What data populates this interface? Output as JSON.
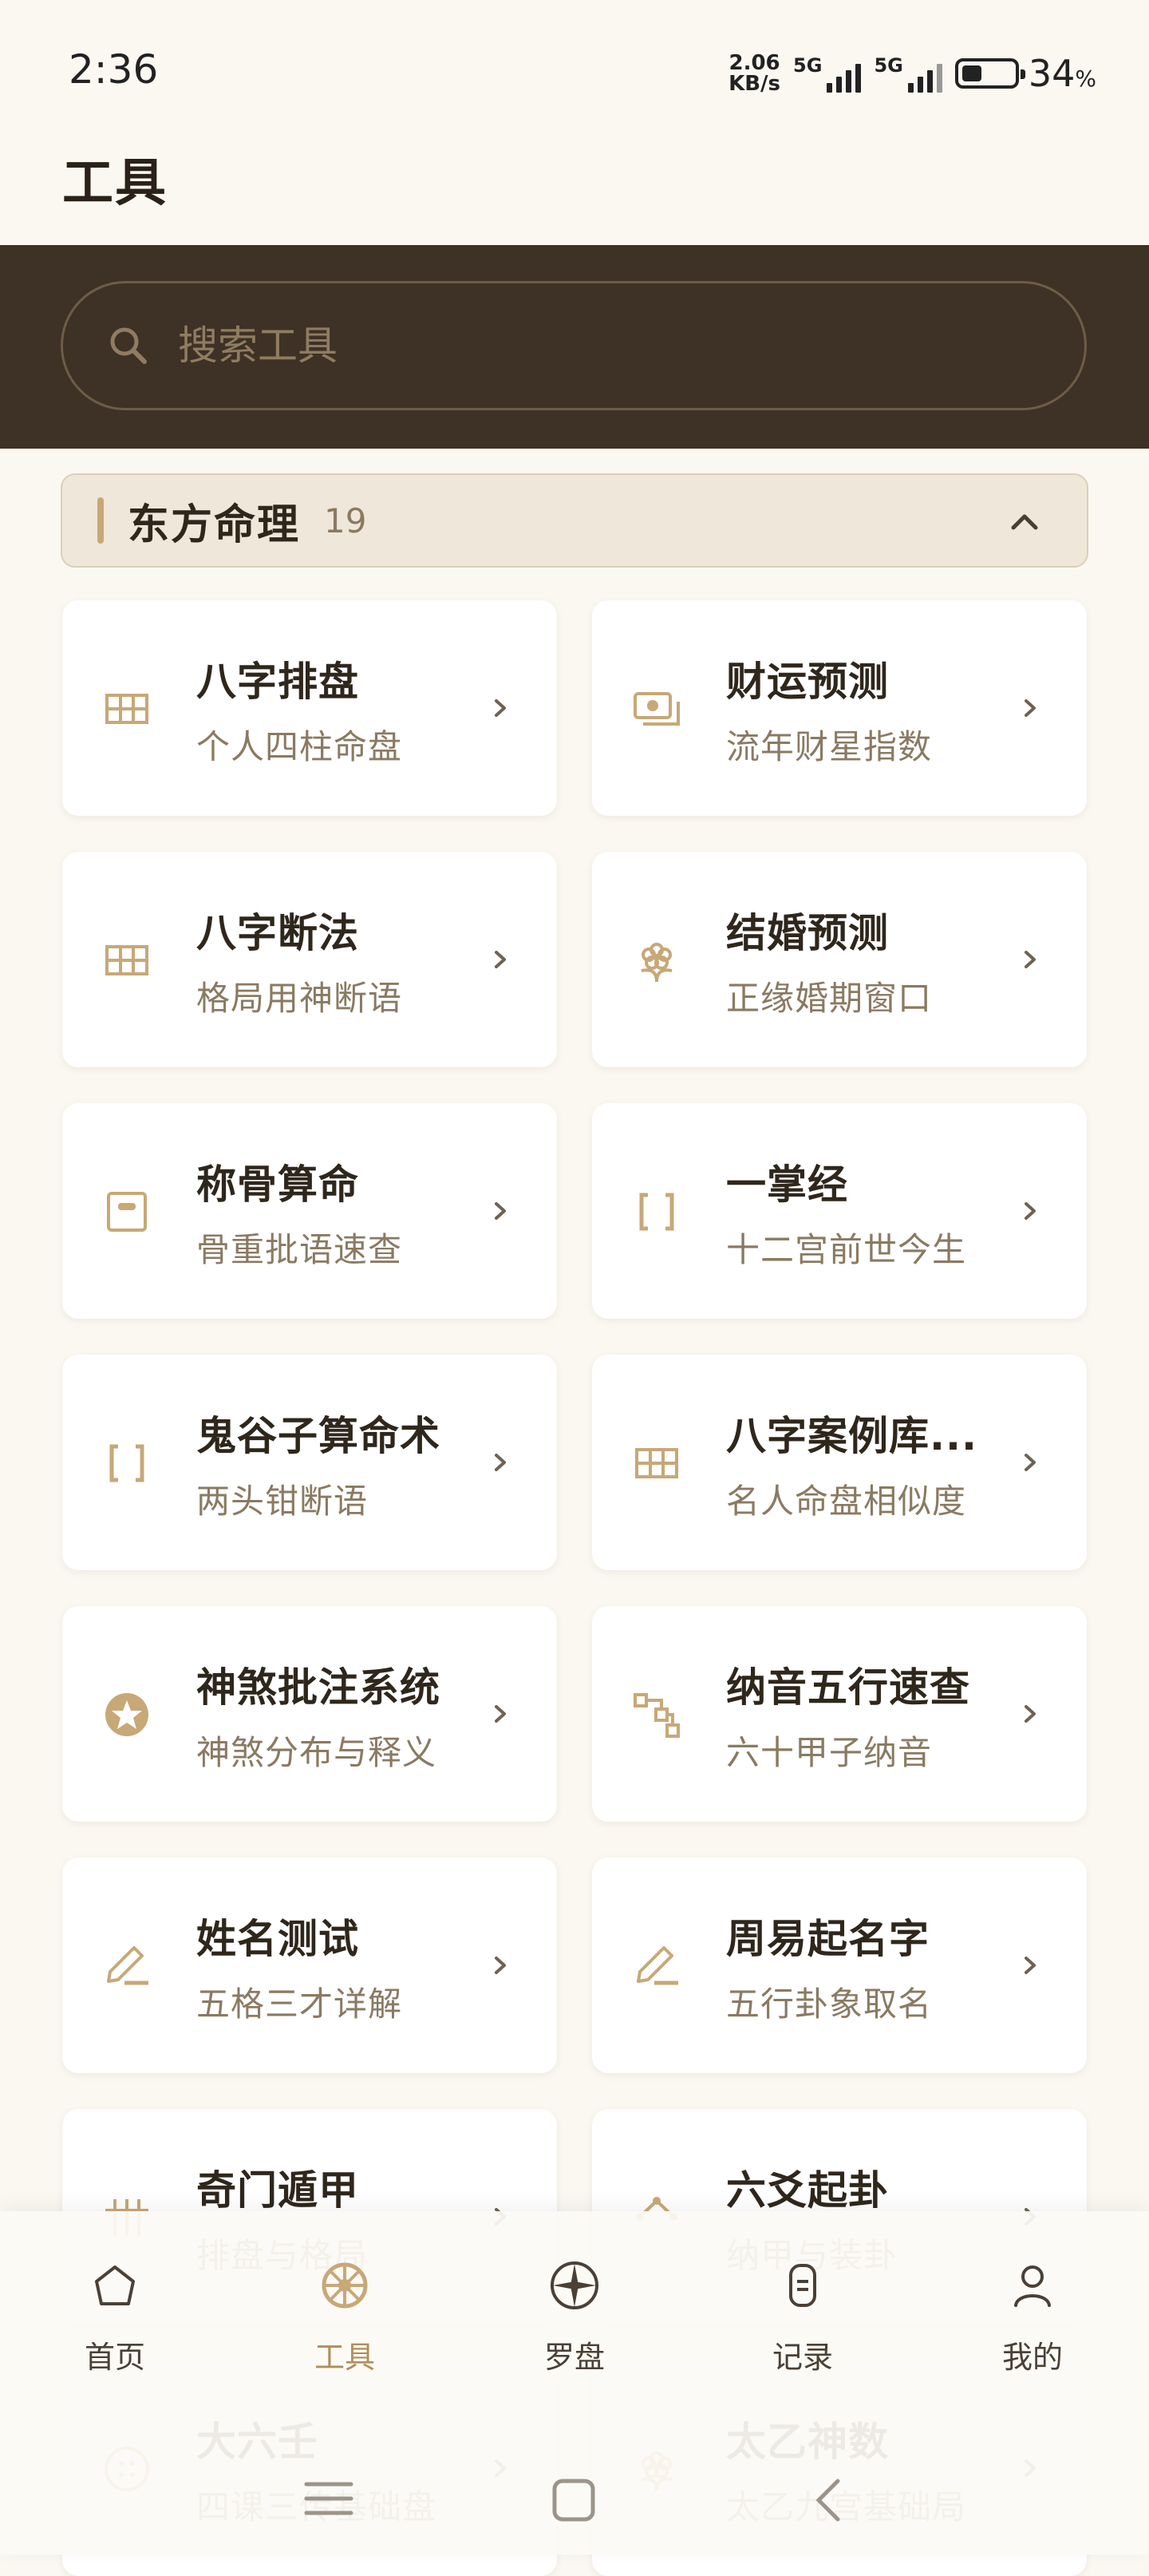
{
  "status": {
    "time": "2:36",
    "speed_value": "2.06",
    "speed_unit": "KB/s",
    "net1": "5G",
    "net2": "5G",
    "battery": "34",
    "battery_unit": "%"
  },
  "header": {
    "title": "工具"
  },
  "search": {
    "placeholder": "搜索工具"
  },
  "category": {
    "name": "东方命理",
    "count": "19"
  },
  "tools": [
    {
      "title": "八字排盘",
      "subtitle": "个人四柱命盘",
      "icon": "grid-icon"
    },
    {
      "title": "财运预测",
      "subtitle": "流年财星指数",
      "icon": "money-icon"
    },
    {
      "title": "八字断法",
      "subtitle": "格局用神断语",
      "icon": "grid-icon"
    },
    {
      "title": "结婚预测",
      "subtitle": "正缘婚期窗口",
      "icon": "flower-icon"
    },
    {
      "title": "称骨算命",
      "subtitle": "骨重批语速查",
      "icon": "scale-icon"
    },
    {
      "title": "一掌经",
      "subtitle": "十二宫前世今生",
      "icon": "bracket-icon"
    },
    {
      "title": "鬼谷子算命术",
      "subtitle": "两头钳断语",
      "icon": "bracket-icon"
    },
    {
      "title": "八字案例库...",
      "subtitle": "名人命盘相似度",
      "icon": "grid-icon"
    },
    {
      "title": "神煞批注系统",
      "subtitle": "神煞分布与释义",
      "icon": "star-icon"
    },
    {
      "title": "纳音五行速查",
      "subtitle": "六十甲子纳音",
      "icon": "nodes-icon"
    },
    {
      "title": "姓名测试",
      "subtitle": "五格三才详解",
      "icon": "pen-icon"
    },
    {
      "title": "周易起名字",
      "subtitle": "五行卦象取名",
      "icon": "pen-icon"
    },
    {
      "title": "奇门遁甲",
      "subtitle": "排盘与格局",
      "icon": "hash-icon"
    },
    {
      "title": "六爻起卦",
      "subtitle": "纳甲与装卦",
      "icon": "hexagram-icon"
    },
    {
      "title": "大六壬",
      "subtitle": "四课三传基础盘",
      "icon": "dots-circle-icon"
    },
    {
      "title": "太乙神数",
      "subtitle": "太乙九宫基础局",
      "icon": "flower-icon"
    }
  ],
  "nav": {
    "items": [
      {
        "label": "首页",
        "icon": "home-icon"
      },
      {
        "label": "工具",
        "icon": "wheel-icon",
        "active": true
      },
      {
        "label": "罗盘",
        "icon": "compass-icon"
      },
      {
        "label": "记录",
        "icon": "record-icon"
      },
      {
        "label": "我的",
        "icon": "user-icon"
      }
    ]
  },
  "colors": {
    "accent": "#C7A877",
    "dark_band": "#3E3125",
    "background": "#FBF8F2",
    "text_primary": "#2F261C",
    "text_secondary": "#8A7A62"
  }
}
